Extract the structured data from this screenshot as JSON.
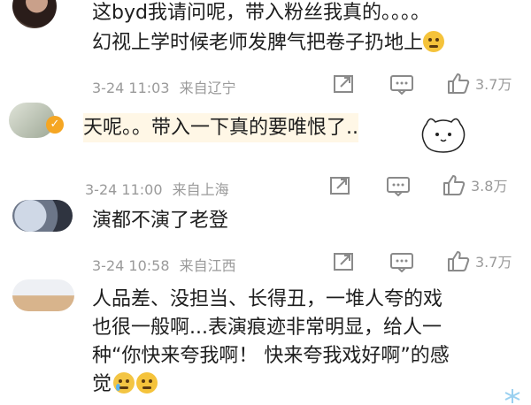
{
  "comments": [
    {
      "text_lines": [
        "这byd我请问呢，带入粉丝我真的。。。。",
        "幻视上学时候老师发脾气把卷子扔地上"
      ],
      "date": "3-24 11:03",
      "location": "来自辽宁",
      "likes": "3.7万"
    },
    {
      "text_lines": [
        "天呢。。带入一下真的要唯恨了.."
      ],
      "date": "3-24 11:00",
      "location": "来自上海",
      "likes": "3.8万"
    },
    {
      "text_lines": [
        "演都不演了老登"
      ],
      "date": "3-24 10:58",
      "location": "来自江西",
      "likes": "3.7万"
    },
    {
      "text_lines": [
        "人品差、没担当、长得丑，一堆人夸的戏",
        "也很一般啊...表演痕迹非常明显，给人一",
        "种“你快来夸我啊！ 快来夸我戏好啊”的感",
        "觉"
      ]
    }
  ],
  "icons": {
    "reply": "reply-icon",
    "comment": "comment-icon",
    "like": "thumbs-up-icon",
    "verified": "verified-badge-icon"
  },
  "colors": {
    "text": "#1e1e1e",
    "meta": "#9a9a9a",
    "verified": "#f5a623"
  }
}
